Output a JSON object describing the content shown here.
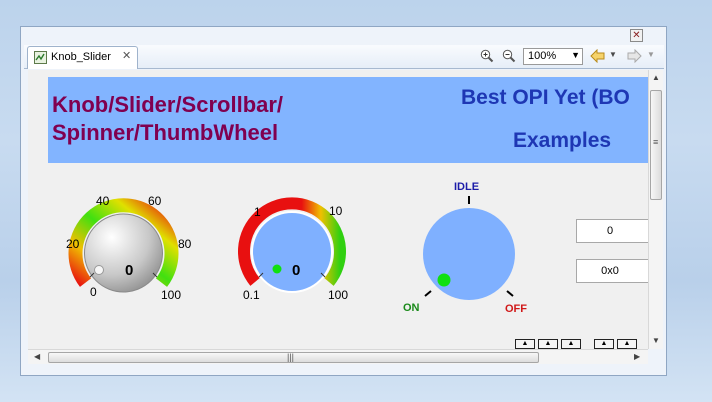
{
  "window": {
    "close_glyph": "✕"
  },
  "tab": {
    "label": "Knob_Slider",
    "close_glyph": "✕",
    "icon": "opi-display-icon"
  },
  "toolbar": {
    "zoom_in_icon": "zoom-in-icon",
    "zoom_out_icon": "zoom-out-icon",
    "zoom_value": "100%",
    "back_icon": "back-arrow-icon",
    "forward_icon": "forward-arrow-icon"
  },
  "banner": {
    "left_text": "Knob/Slider/Scrollbar/\nSpinner/ThumbWheel",
    "right_line1": "Best OPI Yet (BO",
    "right_line2": "Examples",
    "background": "#82b4ff",
    "left_color": "#800050",
    "right_color": "#1e37b4"
  },
  "gauge1": {
    "ticks": [
      "0",
      "20",
      "40",
      "60",
      "80",
      "100"
    ],
    "value": "0"
  },
  "gauge2": {
    "ticks": [
      "0.1",
      "1",
      "10",
      "100"
    ],
    "value": "0"
  },
  "knob3": {
    "top_label": "IDLE",
    "left_label": "ON",
    "right_label": "OFF",
    "colors": {
      "idle": "#1c1ca8",
      "on": "#1a8a1a",
      "off": "#d01818"
    }
  },
  "spinners": [
    {
      "value": "0"
    },
    {
      "value": "0x0"
    }
  ],
  "scrollbars": {
    "h_grip": "|||",
    "v_grip": "≡"
  }
}
